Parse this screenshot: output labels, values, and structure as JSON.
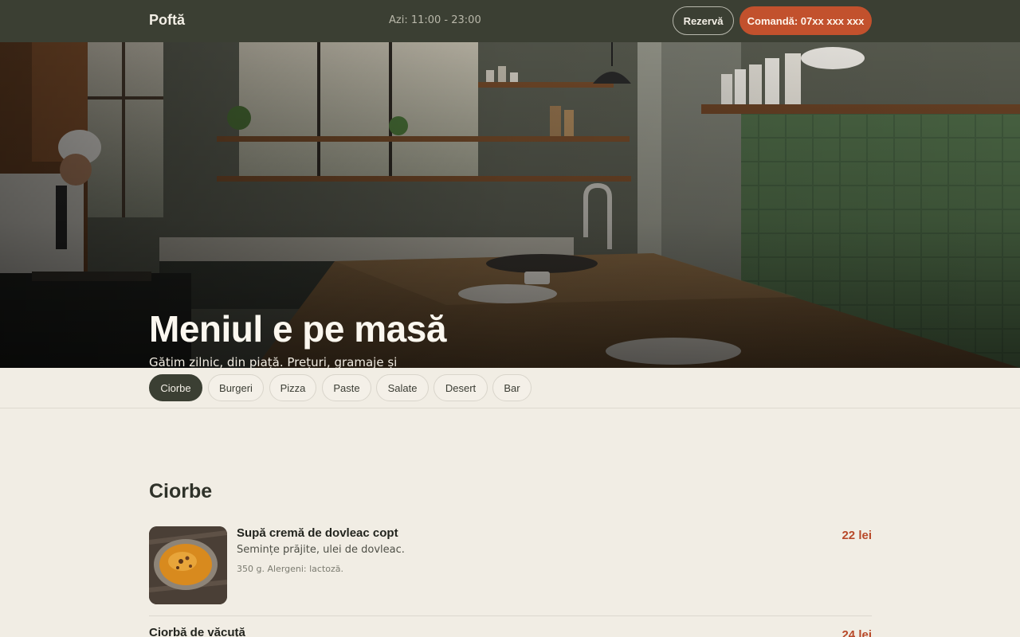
{
  "header": {
    "brand": "Poftă",
    "hours": "Azi: 11:00 - 23:00",
    "reserve_label": "Rezervă",
    "order_label": "Comandă: 07xx xxx xxx"
  },
  "hero": {
    "title": "Meniul e pe masă",
    "subtitle": "Gătim zilnic, din piață. Prețuri, gramaje și alergeni, toate pe pagina asta, fără PDF."
  },
  "tabs": [
    {
      "label": "Ciorbe",
      "active": true
    },
    {
      "label": "Burgeri",
      "active": false
    },
    {
      "label": "Pizza",
      "active": false
    },
    {
      "label": "Paste",
      "active": false
    },
    {
      "label": "Salate",
      "active": false
    },
    {
      "label": "Desert",
      "active": false
    },
    {
      "label": "Bar",
      "active": false
    }
  ],
  "section": {
    "title": "Ciorbe",
    "items": [
      {
        "name": "Supă cremă de dovleac copt",
        "description": "Semințe prăjite, ulei de dovleac.",
        "meta": "350 g. Alergeni: lactoză.",
        "price": "22 lei"
      },
      {
        "name": "Ciorbă de văcuță",
        "price": "24 lei"
      }
    ]
  },
  "colors": {
    "header_bg": "#3b3f33",
    "accent": "#c2512d",
    "price": "#b8492a",
    "page_bg": "#f1ede4"
  }
}
